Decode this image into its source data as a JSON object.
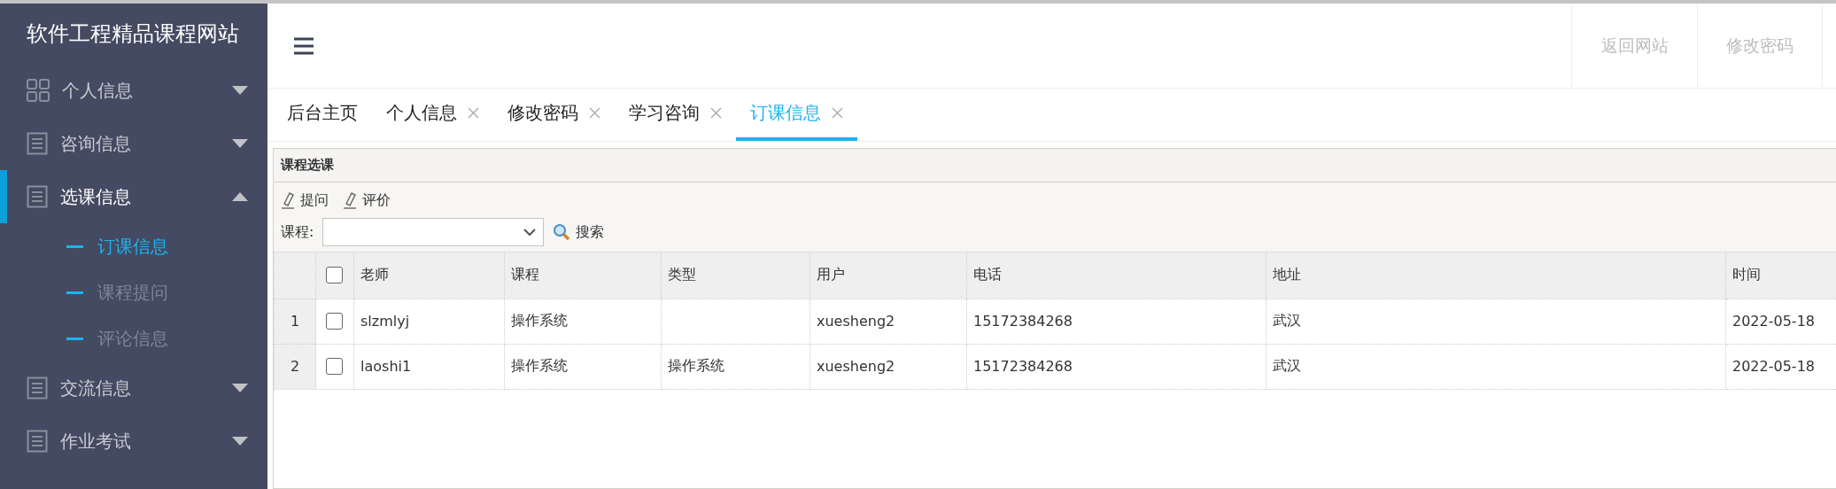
{
  "site_title": "软件工程精品课程网站",
  "sidebar": {
    "items": [
      {
        "label": "个人信息",
        "kind": "grid",
        "expanded": false,
        "selected": false
      },
      {
        "label": "咨询信息",
        "kind": "list",
        "expanded": false,
        "selected": false
      },
      {
        "label": "选课信息",
        "kind": "list",
        "expanded": true,
        "selected": true,
        "children": [
          {
            "label": "订课信息",
            "selected": true
          },
          {
            "label": "课程提问",
            "selected": false
          },
          {
            "label": "评论信息",
            "selected": false
          }
        ]
      },
      {
        "label": "交流信息",
        "kind": "list",
        "expanded": false,
        "selected": false
      },
      {
        "label": "作业考试",
        "kind": "list",
        "expanded": false,
        "selected": false
      }
    ]
  },
  "header": {
    "links": [
      "返回网站",
      "修改密码"
    ]
  },
  "tabs": [
    {
      "label": "后台主页",
      "closable": false,
      "selected": false
    },
    {
      "label": "个人信息",
      "closable": true,
      "selected": false
    },
    {
      "label": "修改密码",
      "closable": true,
      "selected": false
    },
    {
      "label": "学习咨询",
      "closable": true,
      "selected": false
    },
    {
      "label": "订课信息",
      "closable": true,
      "selected": true
    }
  ],
  "panel": {
    "title": "课程选课",
    "toolbar": [
      "提问",
      "评价"
    ],
    "filter": {
      "label": "课程:",
      "search": "搜索"
    },
    "table": {
      "select_all_checked": false,
      "columns": [
        "老师",
        "课程",
        "类型",
        "用户",
        "电话",
        "地址",
        "时间"
      ],
      "rows": [
        {
          "index": "1",
          "checked": false,
          "cells": [
            "slzmlyj",
            "操作系统",
            "",
            "xuesheng2",
            "15172384268",
            "武汉",
            "2022-05-18"
          ]
        },
        {
          "index": "2",
          "checked": false,
          "cells": [
            "laoshi1",
            "操作系统",
            "操作系统",
            "xuesheng2",
            "15172384268",
            "武汉",
            "2022-05-18"
          ]
        }
      ]
    }
  }
}
